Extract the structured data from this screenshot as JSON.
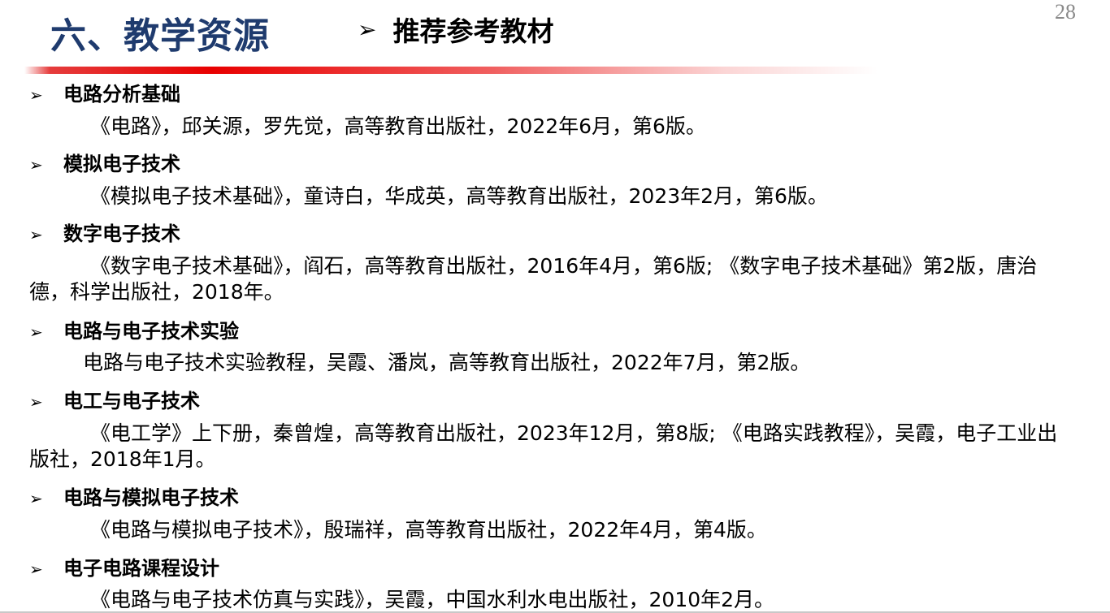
{
  "header": {
    "section_title": "六、教学资源",
    "subtitle": "推荐参考教材",
    "page_number": "28"
  },
  "items": [
    {
      "heading": "电路分析基础",
      "text": "《电路》，邱关源，罗先觉，高等教育出版社，2022年6月，第6版。"
    },
    {
      "heading": "模拟电子技术",
      "text": "《模拟电子技术基础》，童诗白，华成英，高等教育出版社，2023年2月，第6版。"
    },
    {
      "heading": "数字电子技术",
      "text": "《数字电子技术基础》，阎石，高等教育出版社，2016年4月，第6版; 《数字电子技术基础》第2版，唐治德，科学出版社，2018年。"
    },
    {
      "heading": "电路与电子技术实验",
      "text": "电路与电子技术实验教程，吴霞、潘岚，高等教育出版社，2022年7月，第2版。"
    },
    {
      "heading": "电工与电子技术",
      "text": "《电工学》上下册，秦曾煌，高等教育出版社，2023年12月，第8版; 《电路实践教程》，吴霞，电子工业出版社，2018年1月。"
    },
    {
      "heading": "电路与模拟电子技术",
      "text": "《电路与模拟电子技术》，殷瑞祥，高等教育出版社，2022年4月，第4版。"
    },
    {
      "heading": "电子电路课程设计",
      "text": "《电路与电子技术仿真与实践》，吴霞，中国水利水电出版社，2010年2月。"
    }
  ]
}
